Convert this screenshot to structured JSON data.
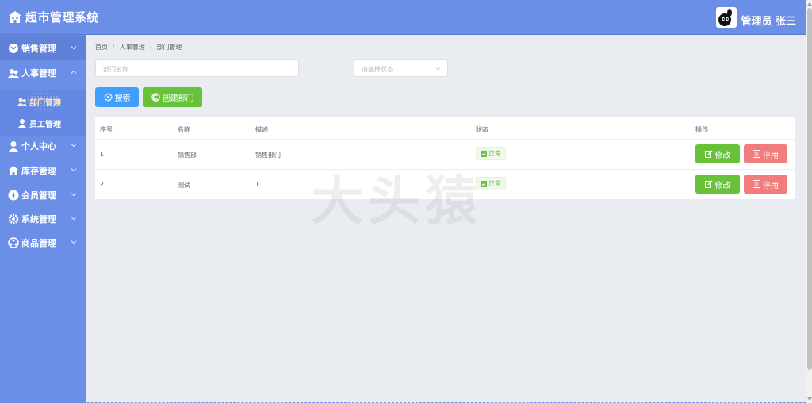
{
  "app": {
    "title": "超市管理系统",
    "logo_icon": "store-icon"
  },
  "user": {
    "name": "管理员 张三",
    "avatar_icon": "avatar-icon"
  },
  "sidebar": {
    "items": [
      {
        "label": "销售管理",
        "icon": "sales-icon"
      },
      {
        "label": "人事管理",
        "icon": "hr-icon",
        "expanded": true,
        "children": [
          {
            "label": "部门管理",
            "icon": "department-icon",
            "current": true
          },
          {
            "label": "员工管理",
            "icon": "employee-icon"
          }
        ]
      },
      {
        "label": "个人中心",
        "icon": "profile-icon"
      },
      {
        "label": "库存管理",
        "icon": "inventory-icon"
      },
      {
        "label": "会员管理",
        "icon": "member-icon"
      },
      {
        "label": "系统管理",
        "icon": "settings-icon"
      },
      {
        "label": "商品管理",
        "icon": "goods-icon"
      }
    ]
  },
  "breadcrumb": [
    "首页",
    "人事管理",
    "部门管理"
  ],
  "filters": {
    "dept_name": {
      "value": "",
      "placeholder": "部门名称"
    },
    "status": {
      "placeholder": "请选择状态"
    }
  },
  "buttons": {
    "search": "搜索",
    "create": "创建部门"
  },
  "table": {
    "headers": [
      "序号",
      "名称",
      "描述",
      "状态",
      "操作"
    ],
    "rows": [
      {
        "no": "1",
        "name": "销售部",
        "desc": "销售部门",
        "status": "正常"
      },
      {
        "no": "2",
        "name": "测试",
        "desc": "1",
        "status": "正常"
      }
    ],
    "actions": {
      "edit": "修改",
      "disable": "停用"
    }
  },
  "watermark": "大头猿",
  "colors": {
    "primary": "#6b8ee6",
    "success": "#67c23a",
    "danger": "#f07c7c",
    "info": "#409eff"
  }
}
